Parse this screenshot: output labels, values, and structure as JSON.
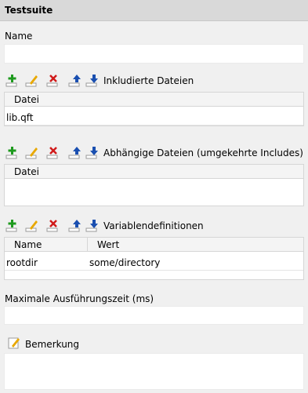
{
  "header": {
    "title": "Testsuite"
  },
  "name_field": {
    "label": "Name",
    "value": ""
  },
  "toolbar_icons": {
    "add": "add-icon",
    "edit": "edit-icon",
    "delete": "delete-icon",
    "move_up": "move-up-icon",
    "move_down": "move-down-icon"
  },
  "colors": {
    "add": "#1e9a1e",
    "edit": "#e8a800",
    "delete": "#d01a1a",
    "arrow": "#1a4fb0",
    "header_bg": "#d9d9d9",
    "background": "#f0f0f0"
  },
  "includes": {
    "title": "Inkludierte Dateien",
    "columns": [
      "Datei"
    ],
    "rows": [
      [
        "lib.qft"
      ]
    ]
  },
  "dependents": {
    "title": "Abhängige Dateien (umgekehrte Includes)",
    "columns": [
      "Datei"
    ],
    "rows": []
  },
  "variables": {
    "title": "Variablendefinitionen",
    "columns": [
      "Name",
      "Wert"
    ],
    "rows": [
      [
        "rootdir",
        "some/directory"
      ]
    ]
  },
  "timeout_field": {
    "label": "Maximale Ausführungszeit (ms)",
    "value": ""
  },
  "comment": {
    "label": "Bemerkung",
    "value": "",
    "icon": "edit-icon"
  }
}
